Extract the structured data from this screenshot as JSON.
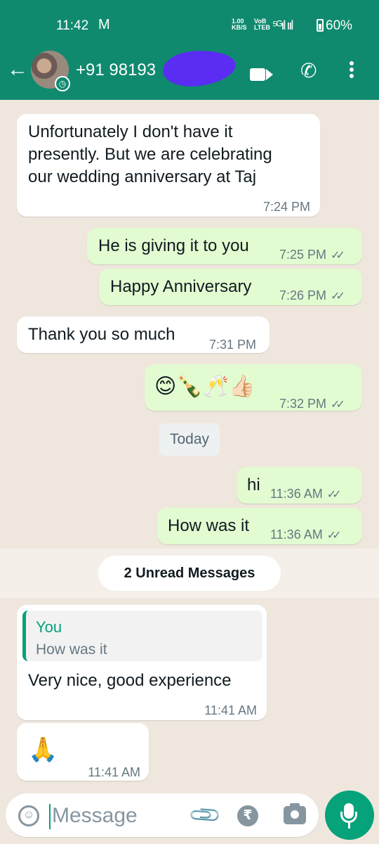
{
  "status_bar": {
    "time": "11:42",
    "mail_icon": "gmail-icon",
    "speed": "1.00\nKB/S",
    "volte": "VoB\nLTEB",
    "network": "5G",
    "signal": "⁵ᴳıl ııl",
    "battery": "60%"
  },
  "header": {
    "back_icon": "back-arrow-icon",
    "contact_name": "+91 98193",
    "icons": [
      "video-call-icon",
      "voice-call-icon",
      "overflow-menu-icon"
    ]
  },
  "messages": [
    {
      "dir": "in",
      "text": "Unfortunately I don't have it\npresently. But we are celebrating\nour wedding anniversary at Taj",
      "time": "7:24 PM"
    },
    {
      "dir": "out",
      "text": "He is giving it to you",
      "time": "7:25 PM"
    },
    {
      "dir": "out",
      "text": "Happy Anniversary",
      "time": "7:26 PM"
    },
    {
      "dir": "in",
      "text": "Thank you so much",
      "time": "7:31 PM"
    },
    {
      "dir": "out",
      "text": "😊🍾🥂👍🏻",
      "time": "7:32 PM"
    },
    {
      "dir": "out",
      "text": "hi",
      "time": "11:36 AM"
    },
    {
      "dir": "out",
      "text": "How was it",
      "time": "11:36 AM"
    },
    {
      "dir": "in",
      "reply": {
        "author": "You",
        "text": "How was it"
      },
      "text": "Very nice, good experience",
      "time": "11:41 AM"
    },
    {
      "dir": "in",
      "text": "🙏",
      "time": "11:41 AM"
    }
  ],
  "ticks": "✓✓",
  "date_divider": "Today",
  "unread_label": "2 Unread Messages",
  "input": {
    "placeholder": "Message",
    "icons": [
      "emoji-icon",
      "attach-icon",
      "rupee-payment-icon",
      "camera-icon",
      "mic-icon"
    ]
  },
  "colors": {
    "header": "#0f8a6f",
    "outgoing_bubble": "#e2fbd0",
    "incoming_bubble": "#ffffff",
    "accent": "#06a27a",
    "wallpaper": "#efe7de"
  }
}
